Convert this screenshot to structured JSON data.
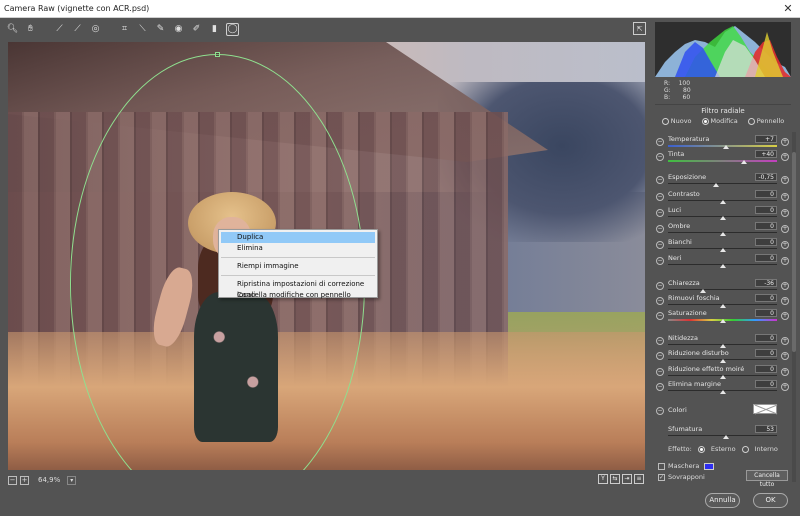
{
  "window": {
    "title": "Camera Raw (vignette con ACR.psd)"
  },
  "toolbar": {
    "tools": [
      "zoom-icon",
      "hand-icon",
      "white-balance-icon",
      "color-sampler-icon",
      "targeted-adjust-icon",
      "crop-icon",
      "straighten-icon",
      "spot-removal-icon",
      "red-eye-icon",
      "adjustment-brush-icon",
      "graduated-filter-icon",
      "radial-filter-icon"
    ]
  },
  "canvas": {
    "zoom": "64,9%"
  },
  "context_menu": {
    "items": [
      {
        "label": "Duplica",
        "highlighted": true
      },
      {
        "label": "Elimina"
      },
      {
        "label": "Riempi immagine"
      },
      {
        "label": "Ripristina impostazioni di correzione locali"
      },
      {
        "label": "Cancella modifiche con pennello"
      }
    ]
  },
  "histogram": {
    "r_label": "R:",
    "g_label": "G:",
    "b_label": "B:",
    "r": "100",
    "g": "80",
    "b": "60"
  },
  "panel": {
    "title": "Filtro radiale",
    "mode_new": "Nuovo",
    "mode_edit": "Modifica",
    "mode_brush": "Pennello",
    "selected_mode": "Modifica"
  },
  "sliders": [
    {
      "label": "Temperatura",
      "value": "+7",
      "pos": 0.53
    },
    {
      "label": "Tinta",
      "value": "+40",
      "pos": 0.7
    },
    {
      "label": "Esposizione",
      "value": "-0,75",
      "pos": 0.44
    },
    {
      "label": "Contrasto",
      "value": "0",
      "pos": 0.5
    },
    {
      "label": "Luci",
      "value": "0",
      "pos": 0.5
    },
    {
      "label": "Ombre",
      "value": "0",
      "pos": 0.5
    },
    {
      "label": "Bianchi",
      "value": "0",
      "pos": 0.5
    },
    {
      "label": "Neri",
      "value": "0",
      "pos": 0.5
    },
    {
      "label": "Chiarezza",
      "value": "-36",
      "pos": 0.32
    },
    {
      "label": "Rimuovi foschia",
      "value": "0",
      "pos": 0.5
    },
    {
      "label": "Saturazione",
      "value": "0",
      "pos": 0.5
    },
    {
      "label": "Nitidezza",
      "value": "0",
      "pos": 0.5
    },
    {
      "label": "Riduzione disturbo",
      "value": "0",
      "pos": 0.5
    },
    {
      "label": "Riduzione effetto moiré",
      "value": "0",
      "pos": 0.5
    },
    {
      "label": "Elimina margine",
      "value": "0",
      "pos": 0.5
    }
  ],
  "colori": {
    "label": "Colori"
  },
  "sfumatura": {
    "label": "Sfumatura",
    "value": "53",
    "pos": 0.53
  },
  "effetto": {
    "label": "Effetto:",
    "outer": "Esterno",
    "inner": "Interno",
    "selected": "Esterno"
  },
  "maschera": {
    "label": "Maschera",
    "checked": false,
    "color": "#2e2ef0"
  },
  "sovrapponi": {
    "label": "Sovrapponi",
    "checked": true
  },
  "buttons": {
    "reset_all": "Cancella tutto",
    "cancel": "Annulla",
    "ok": "OK"
  }
}
